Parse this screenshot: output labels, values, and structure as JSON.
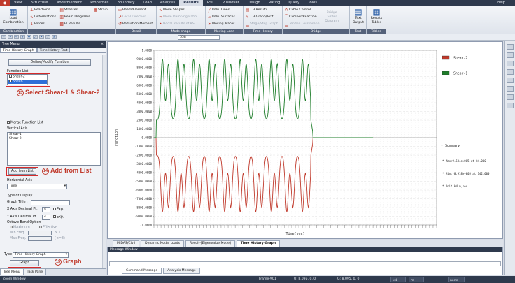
{
  "menubar": {
    "items": [
      "View",
      "Structure",
      "Node/Element",
      "Properties",
      "Boundary",
      "Load",
      "Analysis",
      "Results",
      "PSC",
      "Pushover",
      "Design",
      "Rating",
      "Query",
      "Tools"
    ],
    "active_index": 7,
    "help": "Help"
  },
  "ribbon": {
    "combination": {
      "button": "Load Combination",
      "label": "Combination"
    },
    "forces": {
      "items": [
        "Reactions",
        "Deformations",
        "Forces",
        "Stresses",
        "Beam Diagrams",
        "Hl Results",
        "Strain"
      ],
      "label": ""
    },
    "detail": {
      "items": [
        "Beam/Element",
        "Local Direction",
        "Reduction Moment"
      ],
      "label": "Detail"
    },
    "mode_shape": {
      "items": [
        "Mode Shapes",
        "Mode Damping Ratio",
        "Nodal Results of RS"
      ],
      "label": "Mode shape"
    },
    "moving_load": {
      "items": [
        "Influ. Lines",
        "Influ. Surfaces",
        "Moving Tracer"
      ],
      "label": "Moving Load"
    },
    "time_history": {
      "items": [
        "T.H Results",
        "T.H Graph/Text",
        "Stage/Step Graph"
      ],
      "label": "Time History"
    },
    "bridge": {
      "items": [
        "Cable Control",
        "Camber/Reaction",
        "Tendon Loss Graph",
        "Bridge Girder Diagram"
      ],
      "label": "Bridge"
    },
    "text": {
      "button": "Text Output",
      "label": "Text"
    },
    "tables": {
      "button": "Results Tables",
      "label": "Tables"
    }
  },
  "toolbar": {
    "input_value": "558"
  },
  "panel": {
    "title": "Tree Menu",
    "tabs": [
      "Time History Graph",
      "Time History Text"
    ],
    "define_button": "Define/Modify Function",
    "function_list_label": "Function List",
    "function_list": [
      "Shear-2",
      "Shear-1"
    ],
    "merge_label": "Merge Function List",
    "vertical_axis_label": "Vertical Axis",
    "vertical_axis_list": [
      "Shear-1",
      "Shear-2"
    ],
    "add_button": "Add from List",
    "horizontal_axis_label": "Horizontal Axis",
    "horizontal_axis_value": "Time",
    "display_type_label": "Type of Display",
    "graph_title_label": "Graph Title :",
    "x_decimal_label": "X Axis Decimal Pt.",
    "x_decimal_value": "4",
    "y_decimal_label": "Y Axis Decimal Pt.",
    "y_decimal_value": "4",
    "exp_label": "Exp.",
    "octave_label": "Octave Band Option",
    "maximum_label": "Maximum",
    "effective_label": "Effective",
    "min_freq_label": "Min Freq.",
    "max_freq_label": "Max Freq.",
    "min_freq_hint": "> 1",
    "max_freq_hint": "(<=8)",
    "type_label": "Type",
    "type_value": "Time History Graph",
    "graph_button": "Graph",
    "bottom_tabs": [
      "Tree Menu",
      "Task Pane"
    ]
  },
  "annotations": {
    "a13": {
      "num": "13",
      "text": "Select Shear-1 & Shear-2"
    },
    "a14": {
      "num": "14",
      "text": "Add from List"
    },
    "a15": {
      "num": "15",
      "text": "Graph"
    }
  },
  "chart_data": {
    "type": "line",
    "xlabel": "Time(sec)",
    "ylabel": "Function",
    "ylim": [
      -1000000,
      1000000
    ],
    "y_ticks": [
      1000000,
      900000,
      800000,
      700000,
      600000,
      500000,
      400000,
      300000,
      200000,
      100000,
      0,
      -100000,
      -200000,
      -300000,
      -400000,
      -500000,
      -600000,
      -700000,
      -800000,
      -900000,
      -1000000
    ],
    "y_tick_labels": [
      "1.0000",
      "9000.0000",
      "8000.0000",
      "7000.0000",
      "6000.0000",
      "5000.0000",
      "4000.0000",
      "3000.0000",
      "2000.0000",
      "1000.0000",
      "0.0000",
      "-1000.0000",
      "-2000.0000",
      "-3000.0000",
      "-4000.0000",
      "-5000.0000",
      "-6000.0000",
      "-7000.0000",
      "-8000.0000",
      "-9000.0000",
      "-1.0000"
    ],
    "xlim": [
      0,
      40
    ],
    "grid": true,
    "legend_position": "top-right",
    "series": [
      {
        "name": "Shear-2",
        "color": "#c0392b",
        "pulses": [
          1.2,
          3.4,
          5.6,
          7.8,
          10.0,
          12.2,
          14.4,
          16.6,
          18.8,
          21.0
        ],
        "peak": -850000,
        "baseline": -200000,
        "end": 22.5
      },
      {
        "name": "Shear-1",
        "color": "#1e7d2a",
        "pulses": [
          1.2,
          3.4,
          5.6,
          7.8,
          10.0,
          12.2,
          14.4,
          16.6,
          18.8,
          21.0
        ],
        "peak": 900000,
        "baseline": 200000,
        "end": 22.5
      }
    ],
    "summary": {
      "title": "Summary",
      "lines": [
        "Max:9.534e+005 at 84.000",
        "Min:-8.918e+005 at 142.000",
        "Unit:kN,m,sec"
      ]
    }
  },
  "doctabs": [
    "MIDAS/Civil",
    "Dynamic Nodal Loads",
    "Result-[Eigenvalue Mode]",
    "Time History Graph"
  ],
  "doctab_active": 3,
  "message": {
    "title": "Message Window",
    "tabs": [
      "Command Message",
      "Analysis Message"
    ]
  },
  "status": {
    "left": "Zoom Window",
    "frame": "Frame-901",
    "u": "U: 8.095, 0, 0",
    "g": "G: 8.095, 0, 0",
    "unit1": "kN",
    "unit2": "m",
    "zoom": "none"
  }
}
